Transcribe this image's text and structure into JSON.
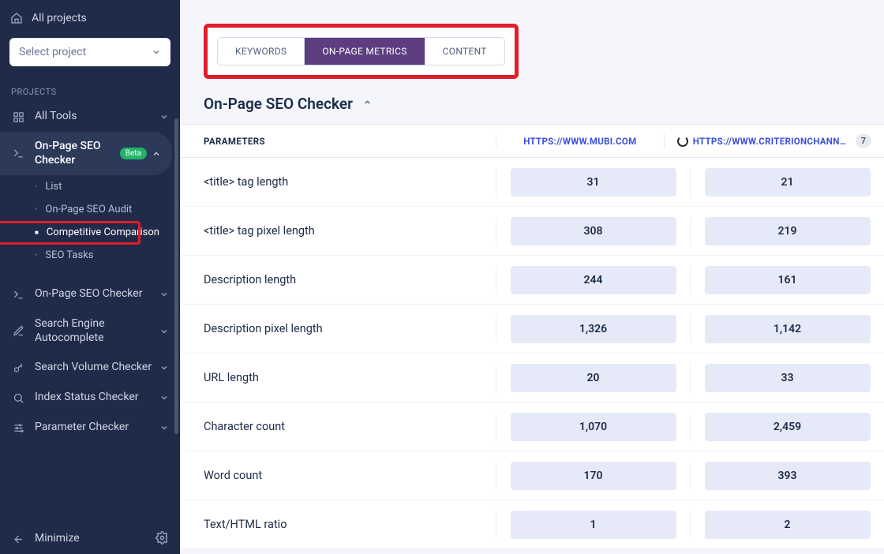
{
  "sidebar": {
    "all_projects": "All projects",
    "select_project_placeholder": "Select project",
    "section_label": "PROJECTS",
    "all_tools": "All Tools",
    "on_page_seo_checker": "On-Page SEO Checker",
    "beta": "Beta",
    "sub": {
      "list": "List",
      "audit": "On-Page SEO Audit",
      "comparison": "Competitive Comparison",
      "tasks": "SEO Tasks"
    },
    "items": {
      "onpage2": "On-Page SEO Checker",
      "autocomplete": "Search Engine Autocomplete",
      "volume": "Search Volume Checker",
      "index": "Index Status Checker",
      "parameter": "Parameter Checker"
    },
    "minimize": "Minimize"
  },
  "tabs": {
    "keywords": "KEYWORDS",
    "onpage": "ON-PAGE METRICS",
    "content": "CONTENT"
  },
  "panel": {
    "title": "On-Page SEO Checker"
  },
  "table": {
    "header_param": "PARAMETERS",
    "site1": "HTTPS://WWW.MUBI.COM",
    "site2": "HTTPS://WWW.CRITERIONCHANNE…",
    "site2_count": "7",
    "rows": [
      {
        "param": "<title> tag length",
        "v1": "31",
        "v2": "21"
      },
      {
        "param": "<title> tag pixel length",
        "v1": "308",
        "v2": "219"
      },
      {
        "param": "Description length",
        "v1": "244",
        "v2": "161"
      },
      {
        "param": "Description pixel length",
        "v1": "1,326",
        "v2": "1,142"
      },
      {
        "param": "URL length",
        "v1": "20",
        "v2": "33"
      },
      {
        "param": "Character count",
        "v1": "1,070",
        "v2": "2,459"
      },
      {
        "param": "Word count",
        "v1": "170",
        "v2": "393"
      },
      {
        "param": "Text/HTML ratio",
        "v1": "1",
        "v2": "2"
      }
    ]
  }
}
